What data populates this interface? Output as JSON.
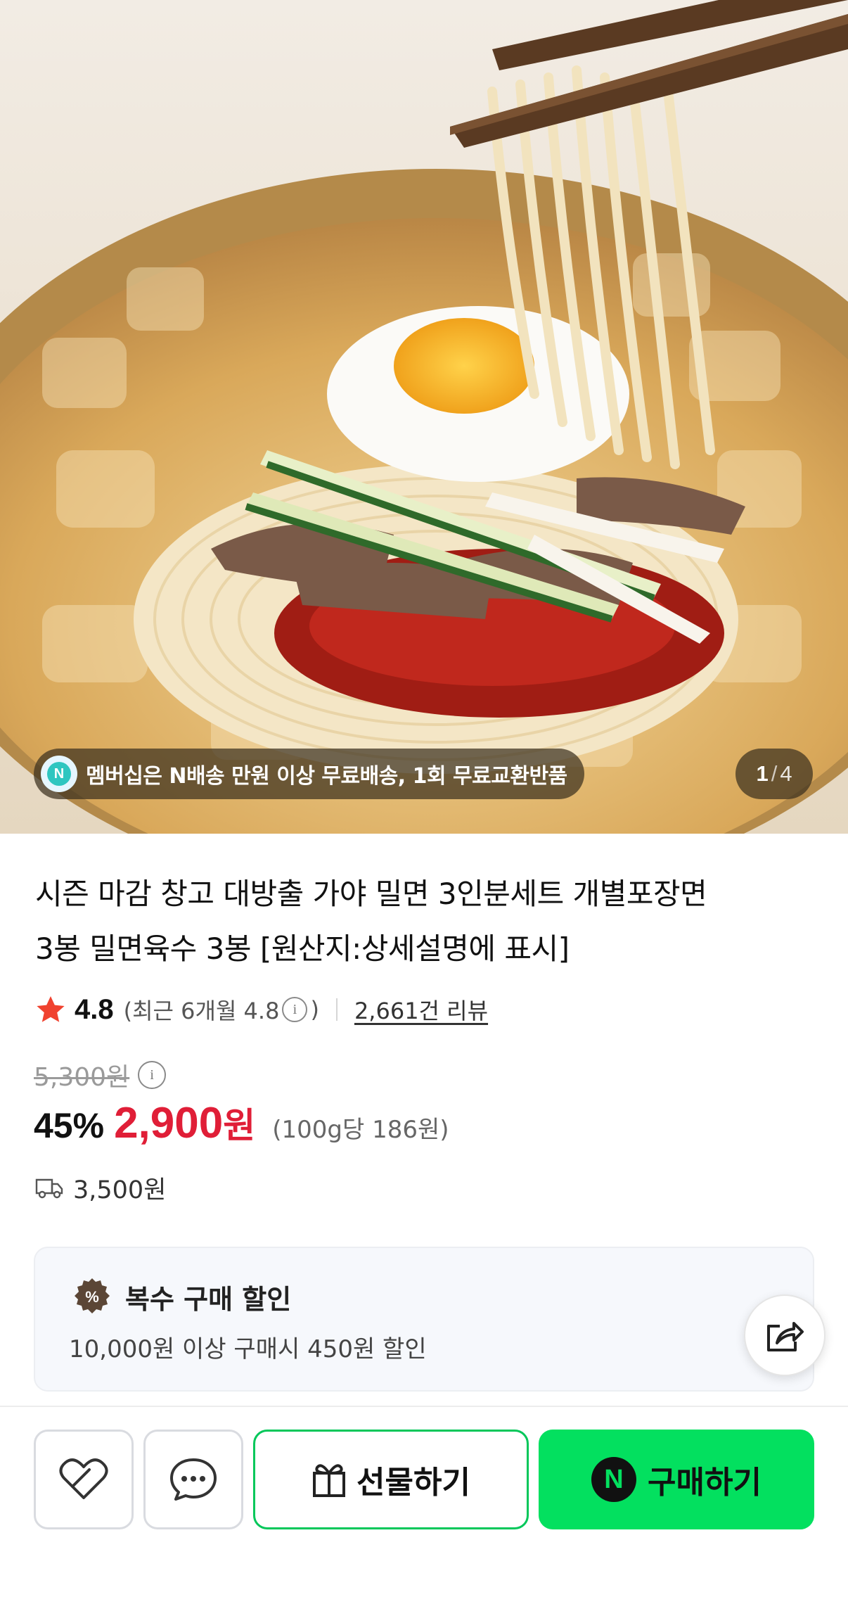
{
  "hero": {
    "member_banner": "멤버십은 N배송 만원 이상 무료배송, 1회 무료교환반품",
    "badge_letter": "N",
    "page_current": "1",
    "page_separator": "/",
    "page_total": "4"
  },
  "product": {
    "title_line1": "시즌 마감 창고 대방출 가야 밀면 3인분세트 개별포장면",
    "title_line2": "3봉 밀면육수 3봉 [원산지:상세설명에 표시]",
    "rating": "4.8",
    "recent_rating": "(최근 6개월 4.8",
    "recent_close": ")",
    "review_count": "2,661건 리뷰",
    "original_price": "5,300원",
    "discount_pct": "45%",
    "sale_price": "2,900",
    "sale_currency": "원",
    "unit_price": "(100g당 186원)",
    "shipping_fee": "3,500원",
    "info_glyph": "i"
  },
  "promo": {
    "title": "복수 구매 할인",
    "badge_glyph": "%",
    "description": "10,000원 이상 구매시 450원 할인"
  },
  "actions": {
    "gift_label": "선물하기",
    "buy_label": "구매하기",
    "buy_badge": "N"
  },
  "colors": {
    "sale_red": "#e01e37",
    "naver_green": "#03e05f",
    "star": "#f0422f"
  },
  "icons": {
    "star": "star-icon",
    "info": "info-icon",
    "truck": "truck-icon",
    "discount": "discount-badge-icon",
    "share": "share-icon",
    "wishlist": "heart-icon",
    "chat": "chat-bubble-icon",
    "gift": "gift-icon"
  }
}
